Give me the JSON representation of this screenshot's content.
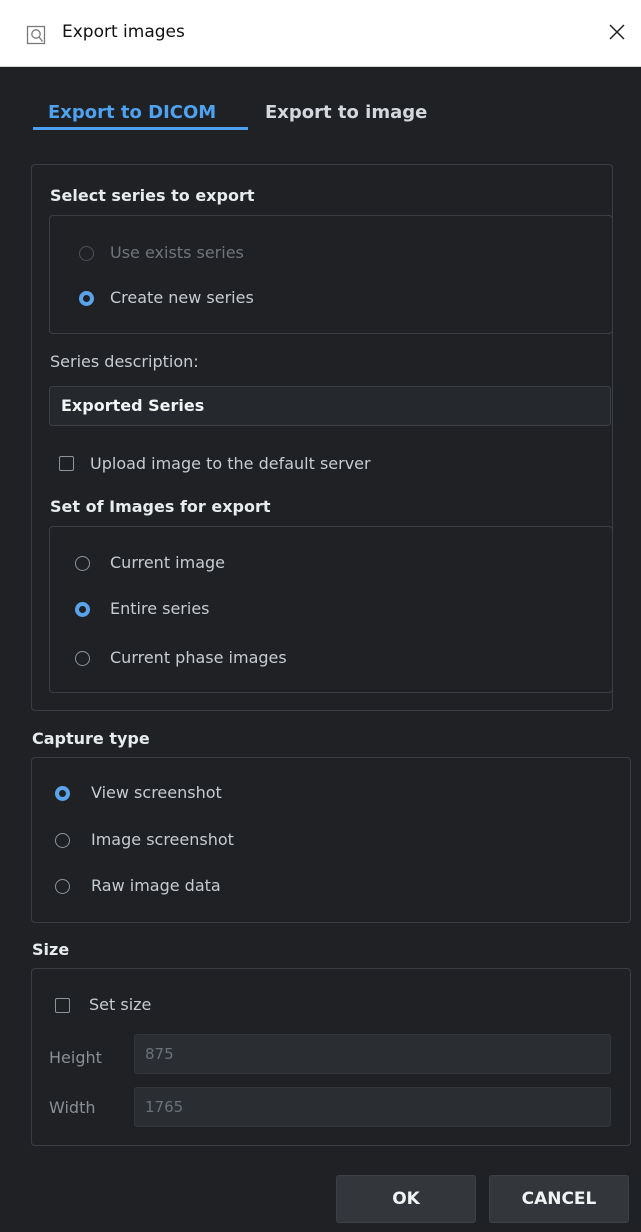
{
  "window": {
    "title": "Export images",
    "title_icon": "export-images-icon",
    "close_icon": "close-icon"
  },
  "tabs": [
    {
      "label": "Export to DICOM",
      "active": true
    },
    {
      "label": "Export to image",
      "active": false
    }
  ],
  "select_series": {
    "title": "Select series to export",
    "options": [
      {
        "label": "Use exists series",
        "selected": false,
        "disabled": true
      },
      {
        "label": "Create new series",
        "selected": true,
        "disabled": false
      }
    ]
  },
  "series_description": {
    "label": "Series description:",
    "value": "Exported Series"
  },
  "upload": {
    "label": "Upload image to the default server",
    "checked": false
  },
  "images_set": {
    "title": "Set of Images for export",
    "options": [
      {
        "label": "Current image",
        "selected": false
      },
      {
        "label": "Entire series",
        "selected": true
      },
      {
        "label": "Current phase images",
        "selected": false
      }
    ]
  },
  "capture_type": {
    "title": "Capture type",
    "options": [
      {
        "label": "View screenshot",
        "selected": true
      },
      {
        "label": "Image screenshot",
        "selected": false
      },
      {
        "label": "Raw image data",
        "selected": false
      }
    ]
  },
  "size": {
    "title": "Size",
    "set_size_label": "Set size",
    "set_size_checked": false,
    "height_label": "Height",
    "height_value": "875",
    "width_label": "Width",
    "width_value": "1765"
  },
  "buttons": {
    "ok": "OK",
    "cancel": "CANCEL"
  },
  "colors": {
    "accent": "#4b9ef0",
    "background": "#1f2124",
    "panel_border": "#3a3e44",
    "button_bg": "#33373c"
  }
}
